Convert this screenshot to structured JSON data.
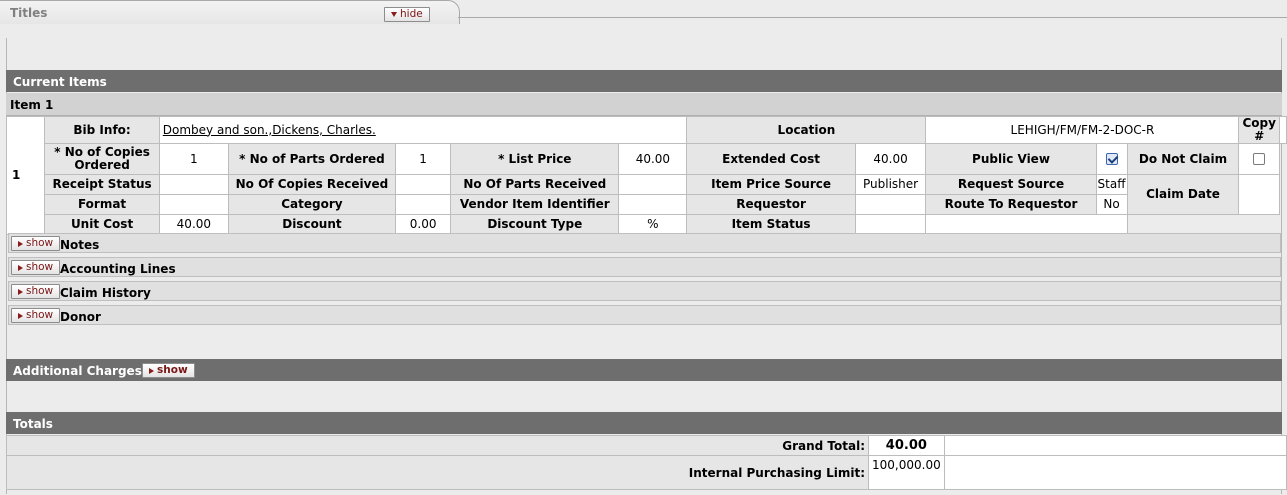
{
  "tab": {
    "title": "Titles",
    "hide_label": "hide"
  },
  "sections": {
    "current_items": "Current Items",
    "additional_charges": "Additional Charges",
    "totals": "Totals"
  },
  "item": {
    "header": "Item 1",
    "row_number": "1",
    "bib_info_label": "Bib Info:",
    "bib_info_value": "Dombey and son.,Dickens, Charles.",
    "location_label": "Location",
    "location_value": "LEHIGH/FM/FM-2-DOC-R",
    "copy_label": "Copy #",
    "copies_ordered_label": "* No of Copies Ordered",
    "copies_ordered_value": "1",
    "parts_ordered_label": "* No of Parts Ordered",
    "parts_ordered_value": "1",
    "list_price_label": "* List Price",
    "list_price_value": "40.00",
    "extended_cost_label": "Extended Cost",
    "extended_cost_value": "40.00",
    "public_view_label": "Public View",
    "public_view_checked": true,
    "do_not_claim_label": "Do Not Claim",
    "do_not_claim_checked": false,
    "receipt_status_label": "Receipt Status",
    "copies_received_label": "No Of Copies Received",
    "parts_received_label": "No Of Parts Received",
    "item_price_source_label": "Item Price Source",
    "item_price_source_value": "Publisher",
    "request_source_label": "Request Source",
    "request_source_value": "Staff",
    "claim_date_label": "Claim Date",
    "format_label": "Format",
    "category_label": "Category",
    "vendor_item_identifier_label": "Vendor Item Identifier",
    "requestor_label": "Requestor",
    "route_to_requestor_label": "Route To Requestor",
    "route_to_requestor_value": "No",
    "unit_cost_label": "Unit Cost",
    "unit_cost_value": "40.00",
    "discount_label": "Discount",
    "discount_value": "0.00",
    "discount_type_label": "Discount Type",
    "discount_type_value": "%",
    "item_status_label": "Item Status"
  },
  "subtabs": [
    {
      "label": "Notes",
      "button": "show"
    },
    {
      "label": "Accounting Lines",
      "button": "show"
    },
    {
      "label": "Claim History",
      "button": "show"
    },
    {
      "label": "Donor",
      "button": "show"
    }
  ],
  "additional_charges_button": "show",
  "totals": {
    "grand_total_label": "Grand Total:",
    "grand_total_value": "40.00",
    "internal_limit_label": "Internal Purchasing Limit:",
    "internal_limit_value": "100,000.00"
  }
}
